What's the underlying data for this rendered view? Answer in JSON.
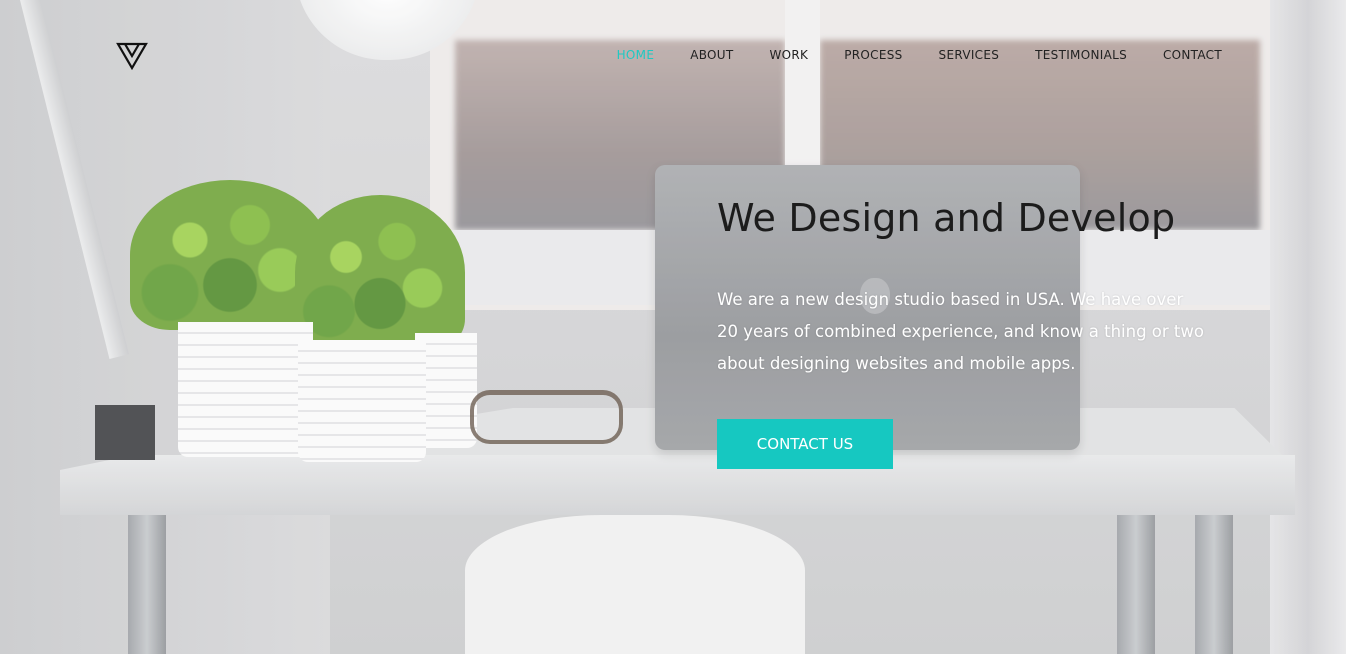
{
  "header": {
    "logo_icon": "triangle-logo-icon",
    "nav": [
      {
        "label": "HOME",
        "active": true
      },
      {
        "label": "ABOUT",
        "active": false
      },
      {
        "label": "WORK",
        "active": false
      },
      {
        "label": "PROCESS",
        "active": false
      },
      {
        "label": "SERVICES",
        "active": false
      },
      {
        "label": "TESTIMONIALS",
        "active": false
      },
      {
        "label": "CONTACT",
        "active": false
      }
    ]
  },
  "hero": {
    "title": "We Design and Develop",
    "description": "We are a new design studio based in USA. We have over 20 years of combined experience, and know a thing or two about designing websites and mobile apps.",
    "cta_label": "CONTACT US"
  },
  "colors": {
    "accent": "#16c8c1",
    "text_dark": "#1c1c1c",
    "nav_text": "#222222"
  }
}
